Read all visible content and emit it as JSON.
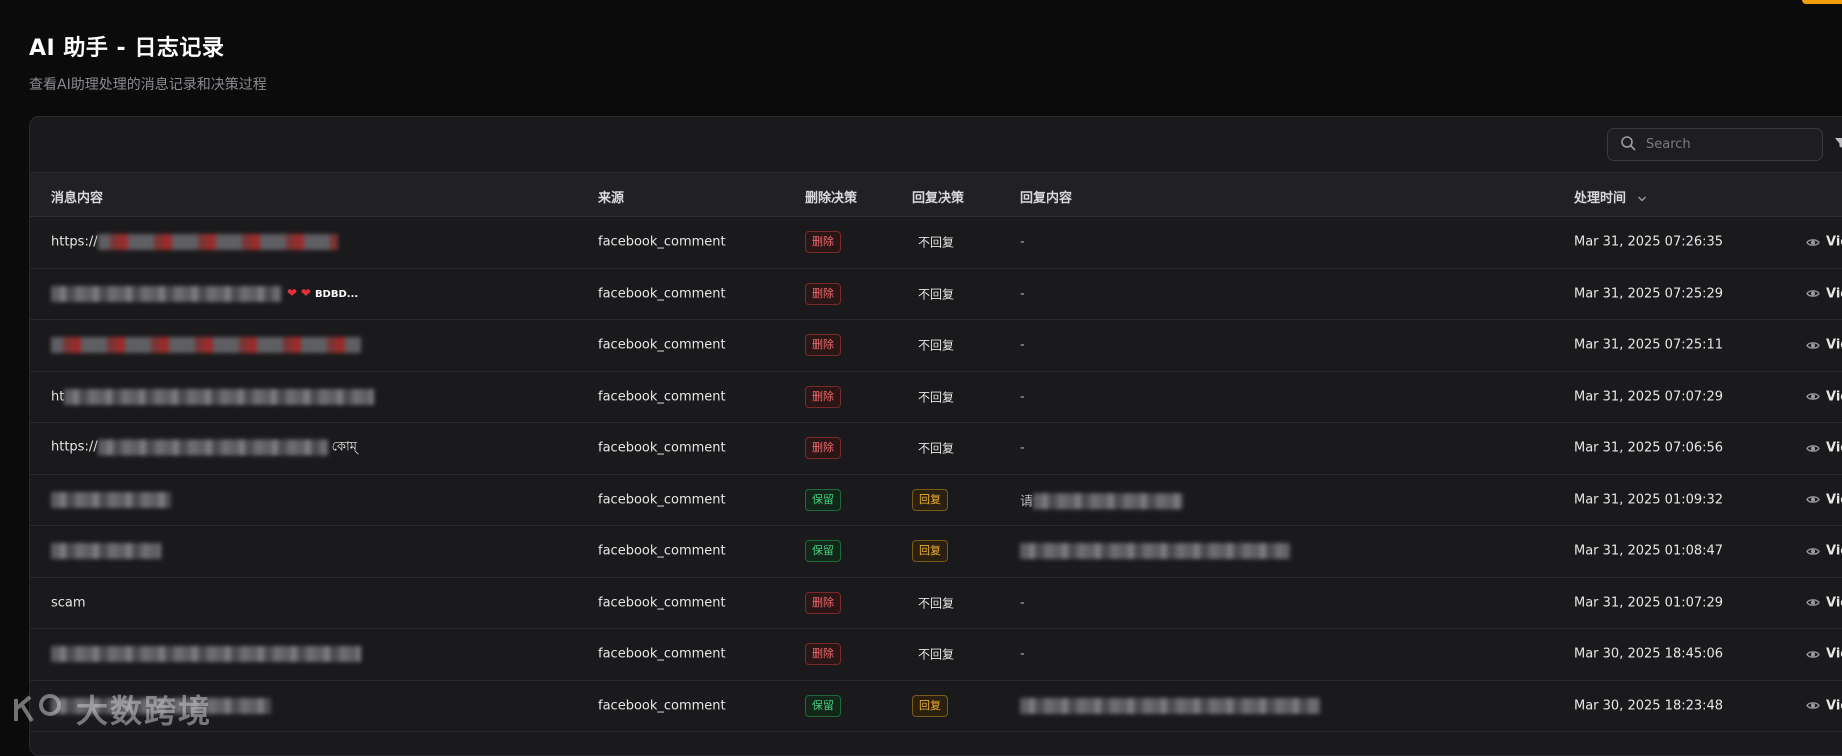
{
  "header": {
    "title": "AI 助手 - 日志记录",
    "subtitle": "查看AI助理处理的消息记录和决策过程"
  },
  "search": {
    "placeholder": "Search"
  },
  "columns": {
    "message": "消息内容",
    "source": "来源",
    "delete_decision": "删除决策",
    "reply_decision": "回复决策",
    "reply_content": "回复内容",
    "time": "处理时间"
  },
  "rows": [
    {
      "msg_prefix": "https://",
      "msg_blur": 240,
      "msg_red": true,
      "msg_suffix": "",
      "source": "facebook_comment",
      "delete": "删除",
      "delete_type": "del",
      "reply": "不回复",
      "reply_type": "plain",
      "content": "-",
      "time": "Mar 31, 2025 07:26:35",
      "view": "View"
    },
    {
      "msg_prefix": "",
      "msg_blur": 230,
      "msg_red": false,
      "msg_suffix": "",
      "hearts": "❤ ❤",
      "tail": "BDBD...",
      "source": "facebook_comment",
      "delete": "删除",
      "delete_type": "del",
      "reply": "不回复",
      "reply_type": "plain",
      "content": "-",
      "time": "Mar 31, 2025 07:25:29",
      "view": "View"
    },
    {
      "msg_prefix": "",
      "msg_blur": 310,
      "msg_red": true,
      "msg_suffix": "",
      "source": "facebook_comment",
      "delete": "删除",
      "delete_type": "del",
      "reply": "不回复",
      "reply_type": "plain",
      "content": "-",
      "time": "Mar 31, 2025 07:25:11",
      "view": "View"
    },
    {
      "msg_prefix": "ht",
      "msg_blur": 310,
      "msg_red": false,
      "msg_suffix": "",
      "source": "facebook_comment",
      "delete": "删除",
      "delete_type": "del",
      "reply": "不回复",
      "reply_type": "plain",
      "content": "-",
      "time": "Mar 31, 2025 07:07:29",
      "view": "View"
    },
    {
      "msg_prefix": "https://",
      "msg_blur": 230,
      "msg_red": false,
      "msg_suffix": "কোম্",
      "source": "facebook_comment",
      "delete": "删除",
      "delete_type": "del",
      "reply": "不回复",
      "reply_type": "plain",
      "content": "-",
      "time": "Mar 31, 2025 07:06:56",
      "view": "View"
    },
    {
      "msg_prefix": "",
      "msg_blur": 120,
      "msg_red": false,
      "msg_suffix": "",
      "source": "facebook_comment",
      "delete": "保留",
      "delete_type": "keep",
      "reply": "回复",
      "reply_type": "reply",
      "content": "请",
      "content_blur": 150,
      "time": "Mar 31, 2025 01:09:32",
      "view": "View"
    },
    {
      "msg_prefix": "",
      "msg_blur": 110,
      "msg_red": false,
      "msg_suffix": "",
      "source": "facebook_comment",
      "delete": "保留",
      "delete_type": "keep",
      "reply": "回复",
      "reply_type": "reply",
      "content": "",
      "content_blur": 270,
      "time": "Mar 31, 2025 01:08:47",
      "view": "View"
    },
    {
      "msg_prefix": "scam",
      "msg_blur": 0,
      "msg_red": false,
      "msg_suffix": "",
      "source": "facebook_comment",
      "delete": "删除",
      "delete_type": "del",
      "reply": "不回复",
      "reply_type": "plain",
      "content": "-",
      "time": "Mar 31, 2025 01:07:29",
      "view": "View"
    },
    {
      "msg_prefix": "",
      "msg_blur": 310,
      "msg_red": false,
      "msg_suffix": "",
      "source": "facebook_comment",
      "delete": "删除",
      "delete_type": "del",
      "reply": "不回复",
      "reply_type": "plain",
      "content": "-",
      "time": "Mar 30, 2025 18:45:06",
      "view": "View"
    },
    {
      "msg_prefix": "",
      "msg_blur": 220,
      "msg_red": false,
      "msg_suffix": "",
      "source": "facebook_comment",
      "delete": "保留",
      "delete_type": "keep",
      "reply": "回复",
      "reply_type": "reply",
      "content": "",
      "content_blur": 300,
      "time": "Mar 30, 2025 18:23:48",
      "view": "View"
    }
  ],
  "watermark": {
    "text": "大数跨境"
  },
  "colors": {
    "background": "#0b0b0c",
    "card": "#1a1a1c",
    "delete": "#f06a6a",
    "keep": "#45d07a",
    "reply": "#f0b030",
    "accent": "#f59e0b"
  },
  "icons": [
    "search-icon",
    "filter-icon",
    "sort-down-icon",
    "eye-icon",
    "watermark-logo"
  ]
}
